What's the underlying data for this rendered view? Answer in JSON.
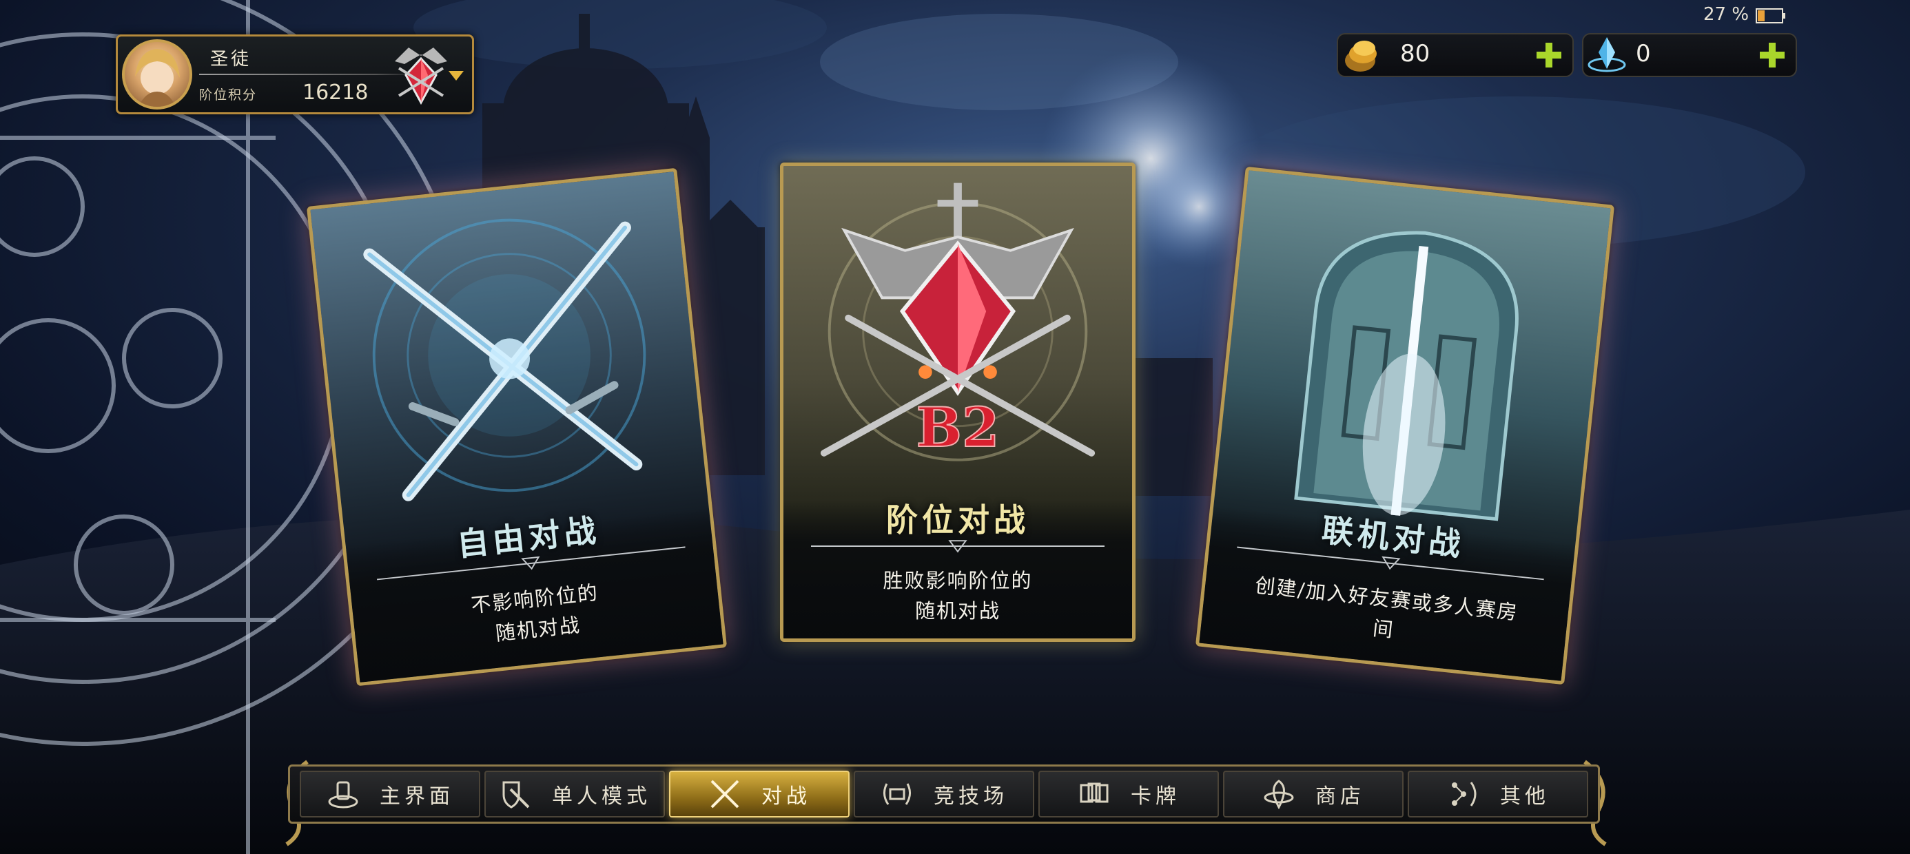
{
  "player": {
    "name": "圣徒",
    "rank_label": "阶位积分",
    "rank_points": "16218"
  },
  "currency": {
    "gold": {
      "value": "80",
      "icon": "gold-coins-icon"
    },
    "gem": {
      "value": "0",
      "icon": "blue-crystal-icon"
    }
  },
  "status": {
    "battery": "27 %"
  },
  "cards": [
    {
      "title": "自由对战",
      "desc_line1": "不影响阶位的",
      "desc_line2": "随机对战",
      "icon": "crossed-swords-icon",
      "title_color": "#cfe9ec"
    },
    {
      "title": "阶位对战",
      "desc_line1": "胜败影响阶位的",
      "desc_line2": "随机对战",
      "icon": "rank-crest-icon",
      "badge": "B2",
      "title_color": "#f1e6a6"
    },
    {
      "title": "联机对战",
      "desc_line1": "创建/加入好友赛或多人赛房",
      "desc_line2": "间",
      "icon": "glowing-door-icon",
      "title_color": "#cfe9ec"
    }
  ],
  "nav": {
    "items": [
      {
        "label": "主界面",
        "icon": "home-icon"
      },
      {
        "label": "单人模式",
        "icon": "sword-shield-icon"
      },
      {
        "label": "对战",
        "icon": "crossed-swords-icon",
        "active": true
      },
      {
        "label": "竞技场",
        "icon": "arena-laurel-icon"
      },
      {
        "label": "卡牌",
        "icon": "cards-icon"
      },
      {
        "label": "商店",
        "icon": "shop-icon"
      },
      {
        "label": "其他",
        "icon": "other-constellation-icon"
      }
    ]
  },
  "colors": {
    "accent_gold": "#c9a04e",
    "active_tab": "#d7b040",
    "plus_green": "#a9d62b"
  }
}
